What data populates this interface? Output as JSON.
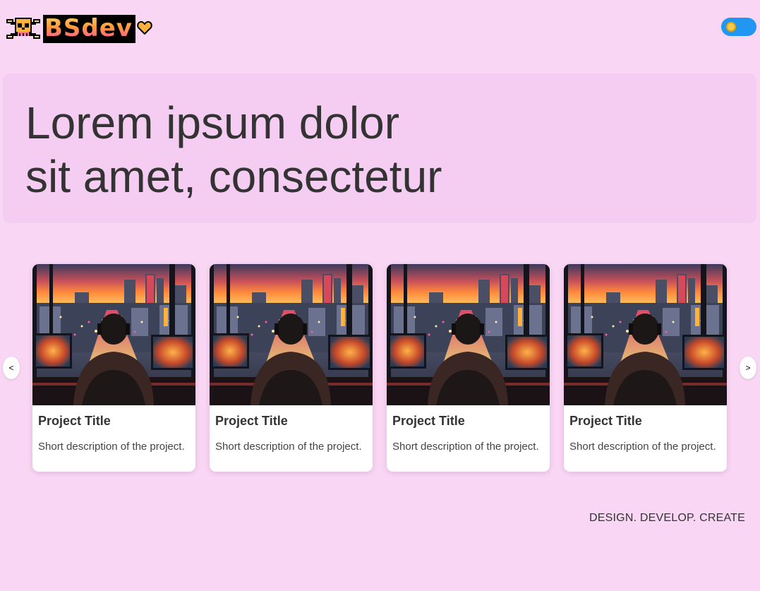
{
  "header": {
    "logo_text": "BSdev",
    "logo_skull_icon": "skull-crossbones-icon",
    "logo_heart_icon": "heart-icon",
    "theme_toggle": {
      "icon": "sun-icon",
      "state": "light",
      "color": "#2196f3"
    }
  },
  "hero": {
    "title_line1": "Lorem ipsum dolor",
    "title_line2": "sit amet, consectetur"
  },
  "carousel": {
    "prev_label": "<",
    "next_label": ">",
    "cards": [
      {
        "title": "Project Title",
        "description": "Short description of the project."
      },
      {
        "title": "Project Title",
        "description": "Short description of the project."
      },
      {
        "title": "Project Title",
        "description": "Short description of the project."
      },
      {
        "title": "Project Title",
        "description": "Short description of the project."
      }
    ]
  },
  "footer": {
    "tagline": "DESIGN. DEVELOP. CREATE"
  },
  "colors": {
    "background": "#f9d7f4",
    "hero_bg": "#f6cdf2",
    "accent": "#2196f3"
  }
}
